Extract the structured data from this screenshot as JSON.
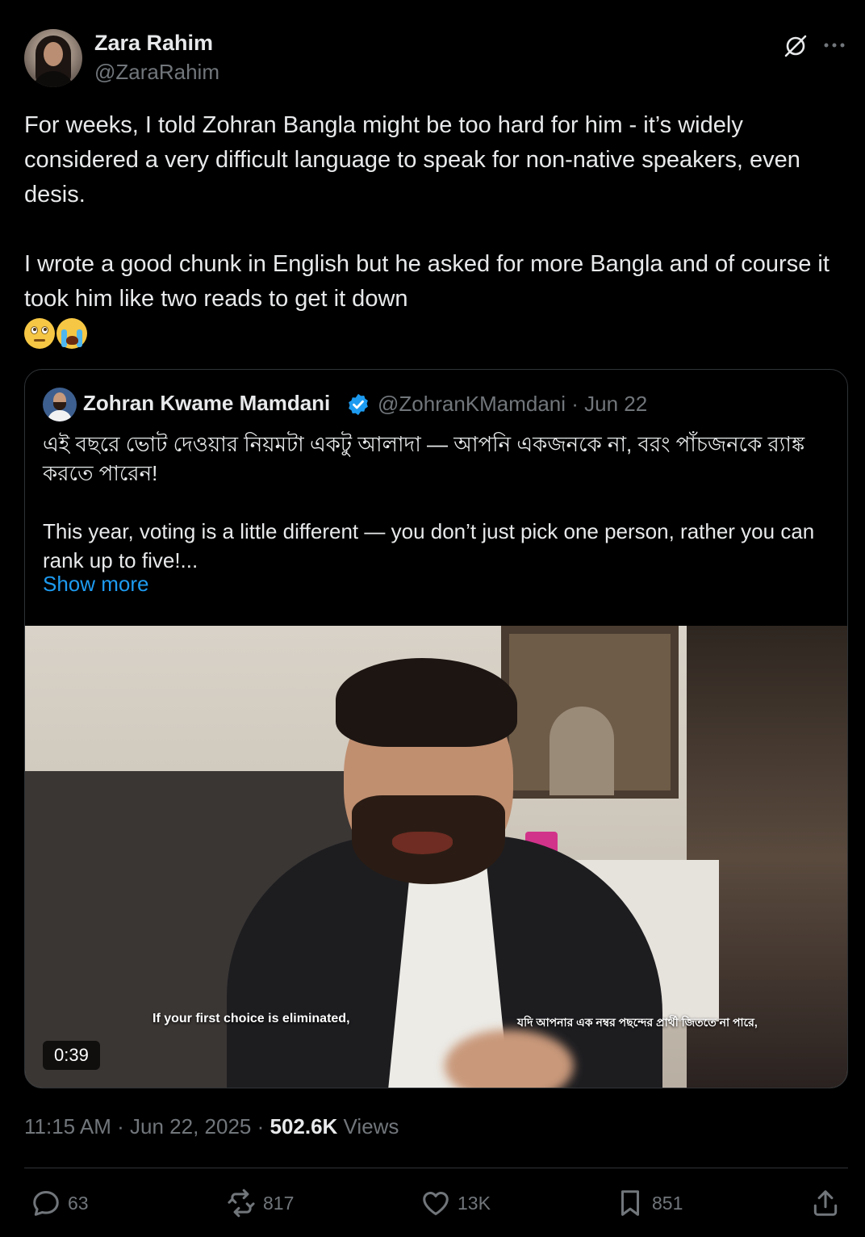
{
  "author": {
    "display_name": "Zara Rahim",
    "handle": "@ZaraRahim"
  },
  "tweet": {
    "text": "For weeks, I told Zohran Bangla might be too hard for him - it’s widely considered a very difficult language to speak for non-native speakers, even desis.\n\nI wrote a good chunk in English but he asked for more Bangla and of course it took him like two reads to get it down",
    "emojis": [
      "face-with-rolling-eyes",
      "loudly-crying-face"
    ]
  },
  "quote": {
    "display_name": "Zohran Kwame Mamdani",
    "handle_date": "@ZohranKMamdani · Jun 22",
    "text": "এই বছরে ভোট দেওয়ার নিয়মটা একটু আলাদা — আপনি একজনকে না, বরং পাঁচজনকে র‍্যাঙ্ক করতে পারেন!\n\nThis year, voting is a little different — you don’t just pick one person, rather you can rank up to five!...",
    "show_more": "Show more",
    "video": {
      "subtitle_en": "If your first choice is eliminated,",
      "subtitle_bn": "যদি আপনার এক নম্বর পছন্দের প্রার্থী জিততে না পারে,",
      "duration": "0:39"
    }
  },
  "meta": {
    "time_date": "11:15 AM · Jun 22, 2025 · ",
    "views_count": "502.6K",
    "views_label": " Views"
  },
  "actions": {
    "replies": "63",
    "reposts": "817",
    "likes": "13K",
    "bookmarks": "851"
  },
  "colors": {
    "background": "#000000",
    "text_primary": "#e7e9ea",
    "text_secondary": "#71767b",
    "link": "#1d9bf0",
    "border": "#2f3336"
  }
}
